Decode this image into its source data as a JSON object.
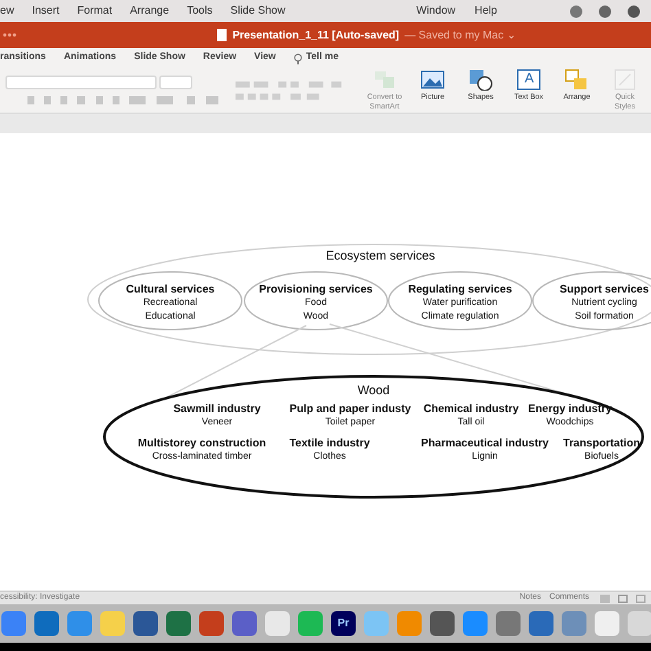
{
  "menu_bar": {
    "items": [
      "ew",
      "Insert",
      "Format",
      "Arrange",
      "Tools",
      "Slide Show",
      "Window",
      "Help"
    ]
  },
  "window": {
    "title": "Presentation_1_11 [Auto-saved]",
    "save_status": "— Saved to my Mac ⌄"
  },
  "ribbon_tabs": [
    {
      "label": "ransitions",
      "selected": false
    },
    {
      "label": "Animations",
      "selected": false
    },
    {
      "label": "Slide Show",
      "selected": false
    },
    {
      "label": "Review",
      "selected": false
    },
    {
      "label": "View",
      "selected": false
    }
  ],
  "tell_me": "Tell me",
  "ribbon_buttons": [
    {
      "kind": "smartart",
      "label": "Convert to SmartArt",
      "disabled": true
    },
    {
      "kind": "picture",
      "label": "Picture",
      "disabled": false
    },
    {
      "kind": "shapes",
      "label": "Shapes",
      "disabled": false
    },
    {
      "kind": "textbox",
      "label": "Text Box",
      "disabled": false,
      "glyph": "A"
    },
    {
      "kind": "arrange",
      "label": "Arrange",
      "disabled": false
    },
    {
      "kind": "styles",
      "label": "Quick Styles",
      "disabled": true
    }
  ],
  "diagram": {
    "title": "Ecosystem services",
    "services": [
      {
        "name": "Cultural services",
        "examples": [
          "Recreational",
          "Educational"
        ]
      },
      {
        "name": "Provisioning services",
        "examples": [
          "Food",
          "Wood"
        ]
      },
      {
        "name": "Regulating services",
        "examples": [
          "Water purification",
          "Climate regulation"
        ]
      },
      {
        "name": "Support services",
        "examples": [
          "Nutrient cycling",
          "Soil formation"
        ]
      }
    ],
    "detail_title": "Wood",
    "uses": [
      {
        "name": "Sawmill industry",
        "example": "Veneer"
      },
      {
        "name": "Pulp and paper industy",
        "example": "Toilet paper"
      },
      {
        "name": "Chemical industry",
        "example": "Tall oil"
      },
      {
        "name": "Energy industry",
        "example": "Woodchips"
      },
      {
        "name": "Multistorey construction",
        "example": "Cross-laminated timber"
      },
      {
        "name": "Textile industry",
        "example": "Clothes"
      },
      {
        "name": "Pharmaceutical industry",
        "example": "Lignin"
      },
      {
        "name": "Transportation",
        "example": "Biofuels"
      }
    ]
  },
  "status_bar": {
    "accessibility": "cessibility: Investigate",
    "notes": "Notes",
    "comments": "Comments"
  },
  "dock": [
    {
      "color": "#3b82f6"
    },
    {
      "color": "#0f6cbd"
    },
    {
      "color": "#2f8fe8"
    },
    {
      "color": "#f5d04a"
    },
    {
      "color": "#2b5797"
    },
    {
      "color": "#1e7145"
    },
    {
      "color": "#c43e1c"
    },
    {
      "color": "#5b5fc7"
    },
    {
      "color": "#e8e8e8"
    },
    {
      "color": "#1db954"
    },
    {
      "color": "#00005b",
      "glyph": "Pr"
    },
    {
      "color": "#7cc4f4"
    },
    {
      "color": "#f08a00"
    },
    {
      "color": "#555555"
    },
    {
      "color": "#1a8cff"
    },
    {
      "color": "#777777"
    },
    {
      "color": "#2a6ab8"
    },
    {
      "color": "#6d8fb8"
    },
    {
      "color": "#efefef"
    },
    {
      "color": "#d8d8d8"
    }
  ]
}
